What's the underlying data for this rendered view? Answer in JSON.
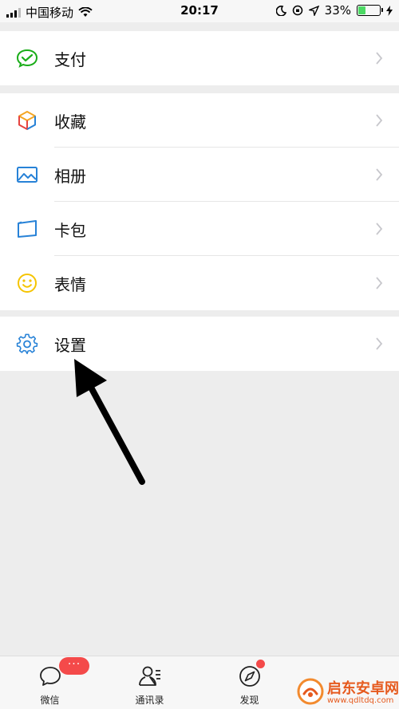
{
  "status_bar": {
    "carrier": "中国移动",
    "time": "20:17",
    "battery_percent": "33%",
    "battery_level": 0.33
  },
  "menu_groups": [
    {
      "items": [
        {
          "label": "支付",
          "icon": "wechat-pay-icon"
        }
      ]
    },
    {
      "items": [
        {
          "label": "收藏",
          "icon": "favorites-cube-icon"
        },
        {
          "label": "相册",
          "icon": "album-picture-icon"
        },
        {
          "label": "卡包",
          "icon": "card-wallet-icon"
        },
        {
          "label": "表情",
          "icon": "smiley-icon"
        }
      ]
    },
    {
      "items": [
        {
          "label": "设置",
          "icon": "gear-icon"
        }
      ]
    }
  ],
  "tabbar": {
    "tabs": [
      {
        "label": "微信",
        "icon": "chat-bubble-icon"
      },
      {
        "label": "通讯录",
        "icon": "contacts-icon"
      },
      {
        "label": "发现",
        "icon": "compass-icon"
      }
    ],
    "chats_badge": "···"
  },
  "watermark": {
    "title": "启东安卓网",
    "url": "www.qdltdq.com"
  },
  "colors": {
    "accent_green": "#1aad19",
    "badge_red": "#f44a4a",
    "watermark_orange": "#e65a1e"
  }
}
